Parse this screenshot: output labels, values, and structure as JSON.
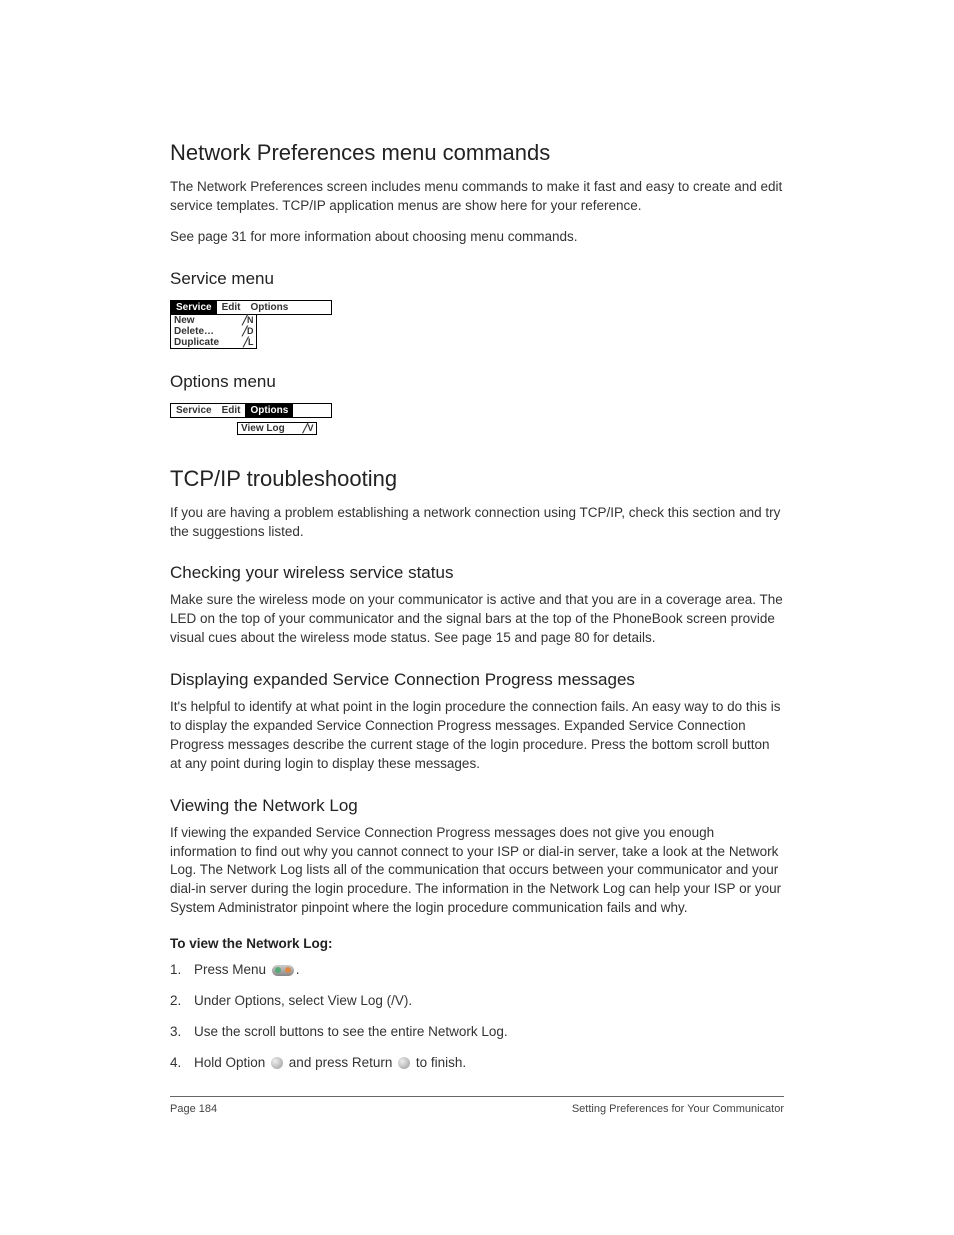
{
  "section1": {
    "title": "Network Preferences menu commands",
    "para1": "The Network Preferences screen includes menu commands to make it fast and easy to create and edit service templates. TCP/IP application menus are show here for your reference.",
    "para2": "See page 31 for more information about choosing menu commands."
  },
  "serviceMenu": {
    "title": "Service menu",
    "tabs": {
      "service": "Service",
      "edit": "Edit",
      "options": "Options"
    },
    "items": [
      {
        "label": "New",
        "shortcut": "╱N"
      },
      {
        "label": "Delete…",
        "shortcut": "╱D"
      },
      {
        "label": "Duplicate",
        "shortcut": "╱L"
      }
    ]
  },
  "optionsMenu": {
    "title": "Options menu",
    "tabs": {
      "service": "Service",
      "edit": "Edit",
      "options": "Options"
    },
    "items": [
      {
        "label": "View Log",
        "shortcut": "╱V"
      }
    ]
  },
  "section2": {
    "title": "TCP/IP troubleshooting",
    "para1": "If you are having a problem establishing a network connection using TCP/IP, check this section and try the suggestions listed."
  },
  "wireless": {
    "title": "Checking your wireless service status",
    "para": "Make sure the wireless mode on your communicator is active and that you are in a coverage area. The LED on the top of your communicator and the signal bars at the top of the PhoneBook screen provide visual cues about the wireless mode status. See page 15 and page 80 for details."
  },
  "progress": {
    "title": "Displaying expanded Service Connection Progress messages",
    "para": "It's helpful to identify at what point in the login procedure the connection fails. An easy way to do this is to display the expanded Service Connection Progress messages. Expanded Service Connection Progress messages describe the current stage of the login procedure. Press the bottom scroll button at any point during login to display these messages."
  },
  "netlog": {
    "title": "Viewing the Network Log",
    "para": "If viewing the expanded Service Connection Progress messages does not give you enough information to find out why you cannot connect to your ISP or dial-in server, take a look at the Network Log. The Network Log lists all of the communication that occurs between your communicator and your dial-in server during the login procedure. The information in the Network Log can help your ISP or your System Administrator pinpoint where the login procedure communication fails and why.",
    "stepsLabel": "To view the Network Log:",
    "step1a": "Press Menu ",
    "step1b": ".",
    "step2": "Under Options, select View Log (/V).",
    "step3": "Use the scroll buttons to see the entire Network Log.",
    "step4a": "Hold Option ",
    "step4b": " and press Return ",
    "step4c": " to finish."
  },
  "footer": {
    "left": "Page 184",
    "right": "Setting Preferences for Your Communicator"
  }
}
